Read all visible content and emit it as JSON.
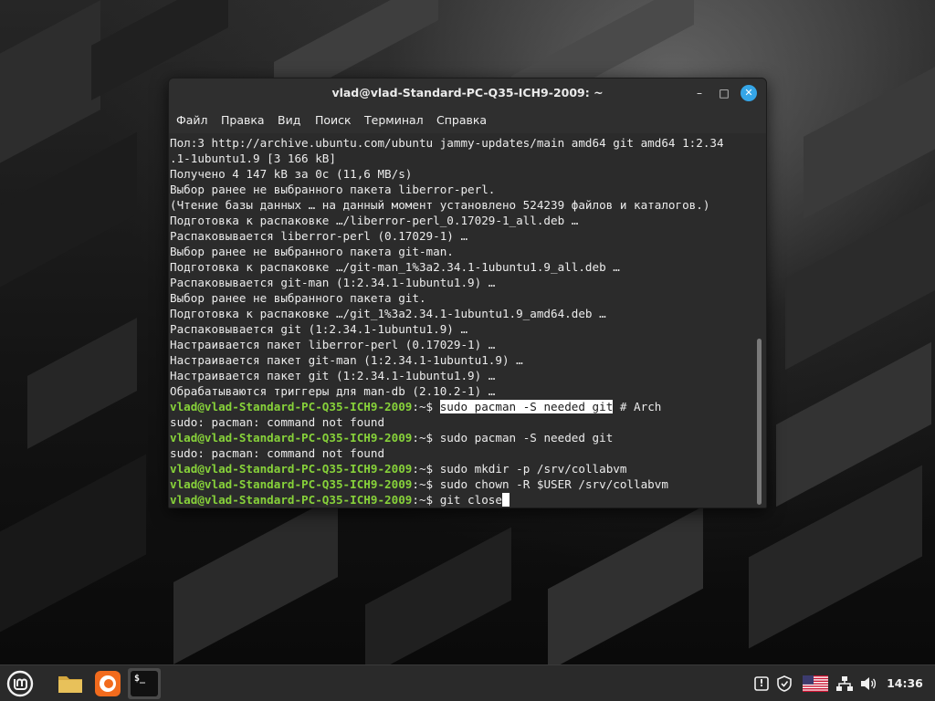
{
  "window": {
    "title": "vlad@vlad-Standard-PC-Q35-ICH9-2009: ~",
    "minimize_glyph": "–",
    "maximize_glyph": "□",
    "close_glyph": "✕"
  },
  "menu": {
    "items": [
      "Файл",
      "Правка",
      "Вид",
      "Поиск",
      "Терминал",
      "Справка"
    ]
  },
  "terminal": {
    "prompt": "vlad@vlad-Standard-PC-Q35-ICH9-2009",
    "prompt_suffix": ":~$ ",
    "output_lines": [
      "Пол:3 http://archive.ubuntu.com/ubuntu jammy-updates/main amd64 git amd64 1:2.34",
      ".1-1ubuntu1.9 [3 166 kB]",
      "Получено 4 147 kB за 0c (11,6 MB/s)",
      "Выбор ранее не выбранного пакета liberror-perl.",
      "(Чтение базы данных … на данный момент установлено 524239 файлов и каталогов.)",
      "Подготовка к распаковке …/liberror-perl_0.17029-1_all.deb …",
      "Распаковывается liberror-perl (0.17029-1) …",
      "Выбор ранее не выбранного пакета git-man.",
      "Подготовка к распаковке …/git-man_1%3a2.34.1-1ubuntu1.9_all.deb …",
      "Распаковывается git-man (1:2.34.1-1ubuntu1.9) …",
      "Выбор ранее не выбранного пакета git.",
      "Подготовка к распаковке …/git_1%3a2.34.1-1ubuntu1.9_amd64.deb …",
      "Распаковывается git (1:2.34.1-1ubuntu1.9) …",
      "Настраивается пакет liberror-perl (0.17029-1) …",
      "Настраивается пакет git-man (1:2.34.1-1ubuntu1.9) …",
      "Настраивается пакет git (1:2.34.1-1ubuntu1.9) …",
      "Обрабатываются триггеры для man-db (2.10.2-1) …"
    ],
    "session": [
      {
        "type": "cmd",
        "selected": "sudo pacman -S needed git",
        "rest": " # Arch"
      },
      {
        "type": "out",
        "text": "sudo: pacman: command not found"
      },
      {
        "type": "cmd",
        "text": "sudo pacman -S needed git"
      },
      {
        "type": "out",
        "text": "sudo: pacman: command not found"
      },
      {
        "type": "cmd",
        "text": "sudo mkdir -p /srv/collabvm"
      },
      {
        "type": "cmd",
        "text": "sudo chown -R $USER /srv/collabvm"
      },
      {
        "type": "cmd",
        "text": "git close",
        "cursor": true
      }
    ]
  },
  "taskbar": {
    "apps": [
      {
        "icon": "linux-mint-menu-icon"
      },
      {
        "icon": "file-manager-folder-icon"
      },
      {
        "icon": "firefox-icon"
      },
      {
        "icon": "terminal-icon",
        "glyph": "$_",
        "active": true
      }
    ],
    "tray": [
      {
        "icon": "update-manager-icon",
        "glyph": "!"
      },
      {
        "icon": "shield-icon"
      },
      {
        "icon": "us-flag-keyboard-layout-icon"
      },
      {
        "icon": "network-icon"
      },
      {
        "icon": "volume-icon"
      }
    ],
    "clock": "14:36"
  },
  "colors": {
    "prompt_green": "#87d23a",
    "terminal_bg": "#2b2b2b",
    "close_button": "#35a6e8",
    "firefox_orange": "#f26b1d",
    "folder_yellow": "#e8c15a"
  }
}
